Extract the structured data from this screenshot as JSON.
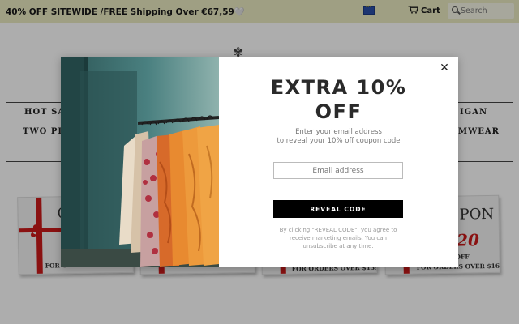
{
  "announcement": "40% OFF SITEWIDE /FREE Shipping Over €67,59🤍",
  "header": {
    "currency_icon": "eu-flag-icon",
    "cart_label": "Cart",
    "cart_icon": "cart-icon",
    "search_placeholder": "Search",
    "search_icon": "search-icon"
  },
  "background": {
    "nav": [
      "HOT SAL",
      "IGAN",
      "TWO PIE",
      "MWEAR"
    ],
    "coupons": [
      {
        "big": "C",
        "small": "FOR C"
      },
      {
        "big": "",
        "small": ""
      },
      {
        "big": "",
        "small": "FOR ORDERS OVER $139"
      },
      {
        "big": "PON",
        "red": "20",
        "off": "OFF",
        "small": "FOR ORDERS OVER $169"
      }
    ]
  },
  "modal": {
    "headline_line1": "EXTRA 10%",
    "headline_line2": "OFF",
    "subtitle_line1": "Enter your email address",
    "subtitle_line2": "to reveal your 10% off coupon code",
    "email_placeholder": "Email address",
    "reveal_button": "REVEAL CODE",
    "legal_text": "By clicking \"REVEAL CODE\", you agree to receive marketing emails. You can unsubscribe at any time.",
    "close_icon": "close-icon"
  },
  "colors": {
    "topbar": "#eaeac1",
    "button": "#000000",
    "ribbon": "#cc1a1a"
  }
}
